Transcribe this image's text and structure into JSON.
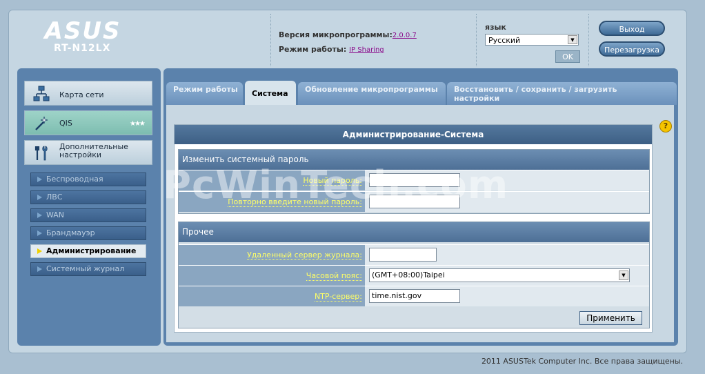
{
  "header": {
    "brand": "ASUS",
    "model": "RT-N12LX",
    "firmware_label": "Версия микропрограммы:",
    "firmware_value": "2.0.0.7",
    "mode_label": "Режим работы:",
    "mode_value": "IP Sharing",
    "language_label": "язык",
    "language_selected": "Русский",
    "ok_label": "OK",
    "logout_label": "Выход",
    "reboot_label": "Перезагрузка"
  },
  "sidebar": {
    "main": [
      {
        "label": "Карта сети",
        "icon": "network-map-icon"
      },
      {
        "label": "QIS",
        "icon": "magic-wand-icon"
      },
      {
        "label": "Дополнительные настройки",
        "icon": "tools-icon"
      }
    ],
    "sub": [
      {
        "label": "Беспроводная"
      },
      {
        "label": "ЛВС"
      },
      {
        "label": "WAN"
      },
      {
        "label": "Брандмауэр"
      },
      {
        "label": "Администрирование",
        "active": true
      },
      {
        "label": "Системный журнал"
      }
    ]
  },
  "tabs": [
    {
      "label": "Режим работы"
    },
    {
      "label": "Система",
      "active": true
    },
    {
      "label": "Обновление микропрограммы"
    },
    {
      "label": "Восстановить / сохранить / загрузить настройки"
    }
  ],
  "main": {
    "title": "Администрирование-Система",
    "password_section": {
      "heading": "Изменить системный пароль",
      "new_password_label": "Новый пароль:",
      "repeat_password_label": "Повторно введите новый пароль:",
      "new_password_value": "",
      "repeat_password_value": ""
    },
    "misc_section": {
      "heading": "Прочее",
      "syslog_label": "Удаленный сервер журнала:",
      "syslog_value": "",
      "timezone_label": "Часовой пояс:",
      "timezone_value": "(GMT+08:00)Taipei",
      "ntp_label": "NTP-сервер:",
      "ntp_value": "time.nist.gov"
    },
    "apply_label": "Применить",
    "help_icon": "?"
  },
  "watermark": "PcWinTech.com",
  "footer": "2011 ASUSTek Computer Inc. Все права защищены.",
  "colors": {
    "panel_blue": "#5b82ac",
    "label_yellow": "#ffff66",
    "title_bar": "#3d5f84"
  }
}
